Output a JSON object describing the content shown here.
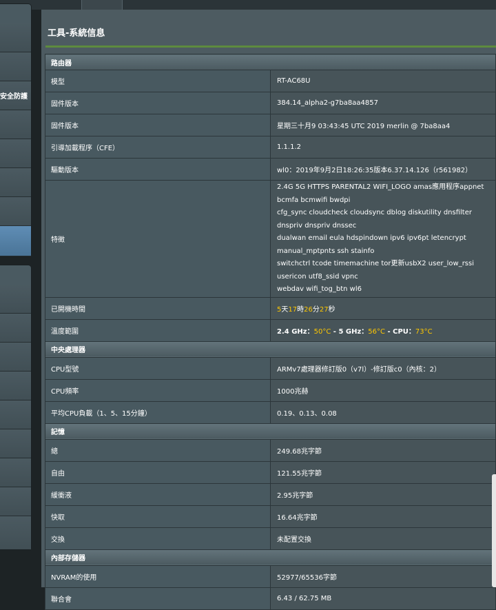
{
  "page": {
    "title": "工具-系統信息"
  },
  "sidebar": {
    "items": [
      {
        "label": ""
      },
      {
        "label": ""
      },
      {
        "label": "安全防護"
      },
      {
        "label": ""
      },
      {
        "label": ""
      },
      {
        "label": ""
      },
      {
        "label": ""
      },
      {
        "label": ""
      }
    ]
  },
  "router": {
    "section_label": "路由器",
    "model_label": "模型",
    "model": "RT-AC68U",
    "firmware_label": "固件版本",
    "firmware": "384.14_alpha2-g7ba8aa4857",
    "build_label": "固件版本",
    "build": "星期三十月9 03:43:45 UTC 2019 merlin @ 7ba8aa4",
    "cfe_label": "引導加載程序（CFE）",
    "cfe": "1.1.1.2",
    "driver_label": "驅動版本",
    "driver": "wl0：2019年9月2日18:26:35版本6.37.14.126（r561982）",
    "features_label": "特徵",
    "features": [
      "2.4G 5G HTTPS PARENTAL2 WIFI_LOGO amas應用程序appnet bcmfa bcmwifi bwdpi",
      "cfg_sync cloudcheck cloudsync dblog diskutility dnsfilter dnspriv dnspriv dnssec",
      "dualwan email eula hdspindown ipv6 ipv6pt letencrypt manual_mptpnts ssh stainfo",
      "switchctrl tcode timemachine tor更新usbX2 user_low_rssi usericon utf8_ssid vpnc",
      "webdav wifi_tog_btn wl6"
    ],
    "uptime_label": "已開機時間",
    "uptime": {
      "days": "5",
      "days_unit": "天",
      "hours": "17",
      "hours_unit": "時",
      "minutes": "26",
      "minutes_unit": "分",
      "seconds": "27",
      "seconds_unit": "秒"
    },
    "temp_label": "溫度範圍",
    "temp": {
      "band1_label": "2.4 GHz：",
      "band1": "50°C",
      "sep1": " - ",
      "band2_label": "5 GHz：",
      "band2": "56°C",
      "sep2": " - ",
      "cpu_label": "CPU：",
      "cpu": "73°C"
    }
  },
  "cpu": {
    "section_label": "中央處理器",
    "model_label": "CPU型號",
    "model": "ARMv7處理器修訂版0（v7l）-修訂版c0（內核：2）",
    "freq_label": "CPU頻率",
    "freq": "1000兆赫",
    "load_label": "平均CPU負載（1、5、15分鐘）",
    "load": "0.19、0.13、0.08"
  },
  "memory": {
    "section_label": "記憶",
    "total_label": "總",
    "total": "249.68兆字節",
    "free_label": "自由",
    "free": "121.55兆字節",
    "buffers_label": "緩衝液",
    "buffers": "2.95兆字節",
    "cache_label": "快取",
    "cache": "16.64兆字節",
    "swap_label": "交換",
    "swap": "未配置交換"
  },
  "storage": {
    "section_label": "內部存儲器",
    "nvram_label": "NVRAM的使用",
    "nvram": "52977/65536字節",
    "jffs_label": "聯合會",
    "jffs": "6.43 / 62.75 MB"
  },
  "colors": {
    "highlight": "#ffc800",
    "accent_divider": "#5d8b3e",
    "active_nav": "#5f8db5",
    "panel_bg": "#4d5b61"
  }
}
